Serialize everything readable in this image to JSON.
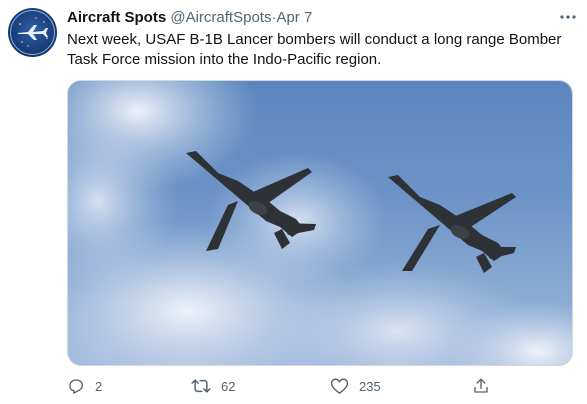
{
  "tweet": {
    "display_name": "Aircraft Spots",
    "handle": "@AircraftSpots",
    "separator": "·",
    "date": "Apr 7",
    "text": "Next week, USAF B-1B Lancer bombers will conduct a long range Bomber Task Force mission into the Indo-Pacific region."
  },
  "actions": {
    "replies": "2",
    "retweets": "62",
    "likes": "235"
  },
  "icons": {
    "more": "more-horizontal-icon",
    "reply": "reply-icon",
    "retweet": "retweet-icon",
    "like": "heart-icon",
    "share": "share-icon"
  },
  "colors": {
    "text": "#0f1419",
    "secondary": "#536471",
    "sky": "#6c93c7"
  }
}
